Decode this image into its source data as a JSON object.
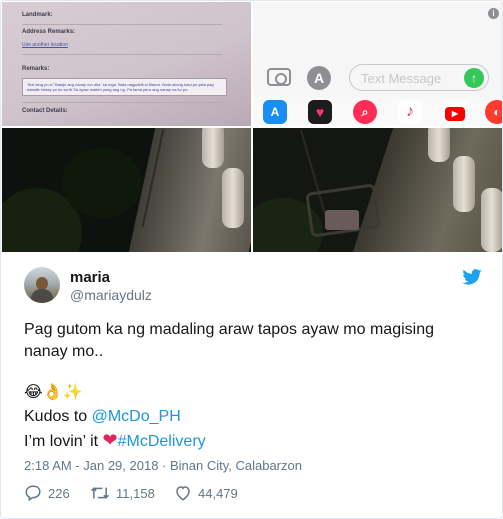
{
  "tweet": {
    "name": "maria",
    "handle": "@mariaydulz",
    "line1": "Pag gutom ka ng madaling araw tapos ayaw mo magising",
    "line2": "nanay mo..",
    "emojis": "😂👌✨",
    "kudos_prefix": "Kudos to ",
    "kudos_mention": "@McDo_PH",
    "lovin_prefix": "I’m lovin’ it ",
    "heart": "❤",
    "hashtag": "#McDelivery",
    "timestamp": "2:18 AM - Jan 29, 2018 · Binan City, Calabarzon",
    "replies": "226",
    "retweets": "11,158",
    "likes": "44,479"
  },
  "media": {
    "form": {
      "landmark": "Landmark:",
      "address_remarks": "Address Remarks:",
      "use_another": "Use another location",
      "remarks": "Remarks:",
      "remarks_text": "Text lang po si \"Balajo ang nanay mo dito\" sa mga. Bata nagpabili si Mama. Wala akong load po yata pag babalik hintay po ko sa fb Sa ayaw maiteh yung ang ng. Pa tama pero ang nanay na ko po.",
      "contact": "Contact Details:"
    },
    "imessage": {
      "placeholder": "Text Message",
      "tray_icons": [
        "app-store-icon",
        "digital-touch-icon",
        "image-search-icon",
        "music-icon",
        "youtube-icon",
        "more-app-icon"
      ]
    }
  },
  "colors": {
    "accent": "#1b95e0",
    "heart": "#e0245e",
    "muted": "#657786"
  }
}
